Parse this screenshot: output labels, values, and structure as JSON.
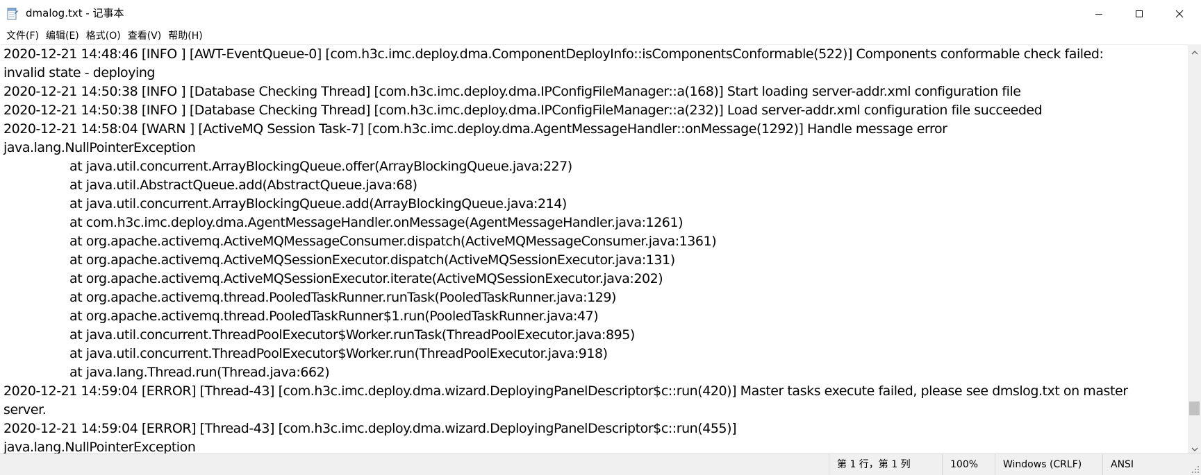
{
  "window": {
    "title": "dmalog.txt - 记事本"
  },
  "menu": [
    {
      "label": "文件(F)"
    },
    {
      "label": "编辑(E)"
    },
    {
      "label": "格式(O)"
    },
    {
      "label": "查看(V)"
    },
    {
      "label": "帮助(H)"
    }
  ],
  "content": {
    "lines": [
      "2020-12-21 14:48:46 [INFO ] [AWT-EventQueue-0] [com.h3c.imc.deploy.dma.ComponentDeployInfo::isComponentsConformable(522)] Components conformable check failed:",
      "invalid state - deploying",
      "2020-12-21 14:50:38 [INFO ] [Database Checking Thread] [com.h3c.imc.deploy.dma.IPConfigFileManager::a(168)] Start loading server-addr.xml configuration file",
      "2020-12-21 14:50:38 [INFO ] [Database Checking Thread] [com.h3c.imc.deploy.dma.IPConfigFileManager::a(232)] Load server-addr.xml configuration file succeeded",
      "2020-12-21 14:58:04 [WARN ] [ActiveMQ Session Task-7] [com.h3c.imc.deploy.dma.AgentMessageHandler::onMessage(1292)] Handle message error",
      "java.lang.NullPointerException",
      "at java.util.concurrent.ArrayBlockingQueue.offer(ArrayBlockingQueue.java:227)",
      "at java.util.AbstractQueue.add(AbstractQueue.java:68)",
      "at java.util.concurrent.ArrayBlockingQueue.add(ArrayBlockingQueue.java:214)",
      "at com.h3c.imc.deploy.dma.AgentMessageHandler.onMessage(AgentMessageHandler.java:1261)",
      "at org.apache.activemq.ActiveMQMessageConsumer.dispatch(ActiveMQMessageConsumer.java:1361)",
      "at org.apache.activemq.ActiveMQSessionExecutor.dispatch(ActiveMQSessionExecutor.java:131)",
      "at org.apache.activemq.ActiveMQSessionExecutor.iterate(ActiveMQSessionExecutor.java:202)",
      "at org.apache.activemq.thread.PooledTaskRunner.runTask(PooledTaskRunner.java:129)",
      "at org.apache.activemq.thread.PooledTaskRunner$1.run(PooledTaskRunner.java:47)",
      "at java.util.concurrent.ThreadPoolExecutor$Worker.runTask(ThreadPoolExecutor.java:895)",
      "at java.util.concurrent.ThreadPoolExecutor$Worker.run(ThreadPoolExecutor.java:918)",
      "at java.lang.Thread.run(Thread.java:662)",
      "2020-12-21 14:59:04 [ERROR] [Thread-43] [com.h3c.imc.deploy.dma.wizard.DeployingPanelDescriptor$c::run(420)] Master tasks execute failed, please see dmslog.txt on master",
      "server.",
      "2020-12-21 14:59:04 [ERROR] [Thread-43] [com.h3c.imc.deploy.dma.wizard.DeployingPanelDescriptor$c::run(455)]",
      "java.lang.NullPointerException"
    ]
  },
  "status": {
    "position": "第 1 行，第 1 列",
    "zoom": "100%",
    "line_ending": "Windows (CRLF)",
    "encoding": "ANSI"
  },
  "scrollbar": {
    "position_fraction": 0.93
  },
  "icons": {
    "app": "notepad-icon",
    "minimize": "minimize-icon",
    "maximize": "maximize-icon",
    "close": "close-icon",
    "scroll_up": "chevron-up-icon",
    "scroll_down": "chevron-down-icon",
    "grip": "resize-grip-icon"
  }
}
